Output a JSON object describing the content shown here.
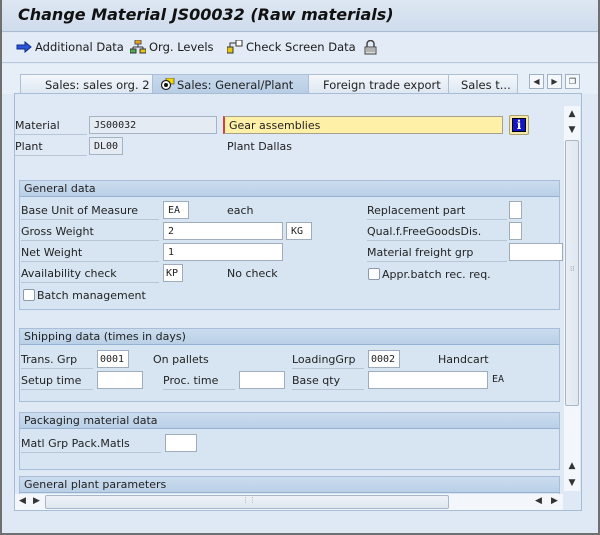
{
  "window": {
    "title": "Change Material JS00032 (Raw materials)"
  },
  "toolbar": {
    "additional_data": "Additional Data",
    "org_levels": "Org. Levels",
    "check_screen_data": "Check Screen Data"
  },
  "tabs": [
    {
      "label": "Sales: sales org. 2",
      "active": false
    },
    {
      "label": "Sales: General/Plant",
      "active": true
    },
    {
      "label": "Foreign trade export",
      "active": false
    },
    {
      "label": "Sales t...",
      "active": false
    }
  ],
  "header": {
    "material_label": "Material",
    "material_value": "JS00032",
    "material_desc": "Gear assemblies",
    "plant_label": "Plant",
    "plant_value": "DL00",
    "plant_desc": "Plant Dallas"
  },
  "general_data": {
    "title": "General data",
    "base_uom_label": "Base Unit of Measure",
    "base_uom_value": "EA",
    "base_uom_desc": "each",
    "gross_weight_label": "Gross Weight",
    "gross_weight_value": "2",
    "weight_unit": "KG",
    "net_weight_label": "Net Weight",
    "net_weight_value": "1",
    "availability_label": "Availability check",
    "availability_value": "KP",
    "availability_desc": "No check",
    "batch_mgmt_label": "Batch management",
    "batch_mgmt_checked": false,
    "replacement_part_label": "Replacement part",
    "replacement_part_value": "",
    "qual_free_goods_label": "Qual.f.FreeGoodsDis.",
    "qual_free_goods_value": "",
    "freight_grp_label": "Material freight grp",
    "freight_grp_value": "",
    "appr_batch_label": "Appr.batch rec. req.",
    "appr_batch_checked": false
  },
  "shipping_data": {
    "title": "Shipping data (times in days)",
    "trans_grp_label": "Trans. Grp",
    "trans_grp_value": "0001",
    "trans_grp_desc": "On pallets",
    "loading_grp_label": "LoadingGrp",
    "loading_grp_value": "0002",
    "loading_grp_desc": "Handcart",
    "setup_time_label": "Setup time",
    "setup_time_value": "",
    "proc_time_label": "Proc. time",
    "proc_time_value": "",
    "base_qty_label": "Base qty",
    "base_qty_value": "",
    "base_qty_unit": "EA"
  },
  "packaging": {
    "title": "Packaging material data",
    "matl_grp_label": "Matl Grp Pack.Matls",
    "matl_grp_value": ""
  },
  "plant_params": {
    "title": "General plant parameters"
  },
  "colors": {
    "required_field_bg": "#fff0a8",
    "info_button_bg": "#1414c8"
  }
}
